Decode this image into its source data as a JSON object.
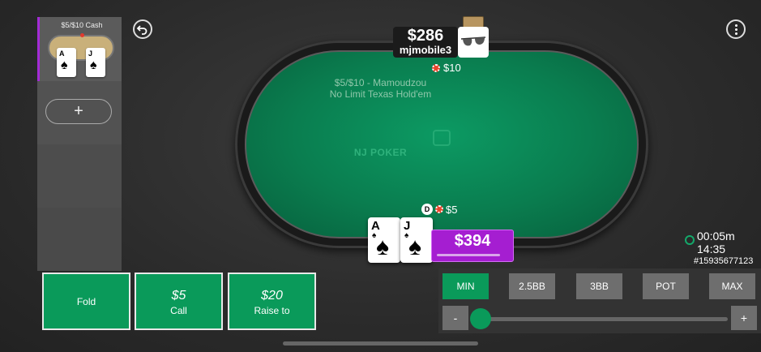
{
  "side_panel": {
    "tables": [
      {
        "label": "$5/$10 Cash",
        "cards": [
          {
            "rank": "A",
            "suit": "♠"
          },
          {
            "rank": "J",
            "suit": "♠"
          }
        ]
      }
    ],
    "add_table_label": "+"
  },
  "table": {
    "stakes": "$5/$10 - Mamoudzou",
    "game": "No Limit Texas Hold'em",
    "logo_text": "NJ POKER"
  },
  "opponent": {
    "stack": "$286",
    "name": "mjmobile3",
    "bet": "$10"
  },
  "hero": {
    "dealer_label": "D",
    "bet": "$5",
    "stack": "$394",
    "cards": [
      {
        "rank": "A",
        "suit": "♠"
      },
      {
        "rank": "J",
        "suit": "♠"
      }
    ]
  },
  "session": {
    "elapsed": "00:05m",
    "clock": "14:35",
    "hand_id": "#15935677123"
  },
  "actions": {
    "fold_label": "Fold",
    "call_amount": "$5",
    "call_label": "Call",
    "raise_amount": "$20",
    "raise_label": "Raise to"
  },
  "bet_sizing": {
    "presets": [
      "MIN",
      "2.5BB",
      "3BB",
      "POT",
      "MAX"
    ],
    "selected": "MIN",
    "minus_label": "-",
    "plus_label": "+",
    "slider_fraction": 0
  },
  "colors": {
    "accent": "#0a9a5a",
    "hero_stack_bg": "#a51ed1",
    "felt": "#0a7d4f"
  }
}
